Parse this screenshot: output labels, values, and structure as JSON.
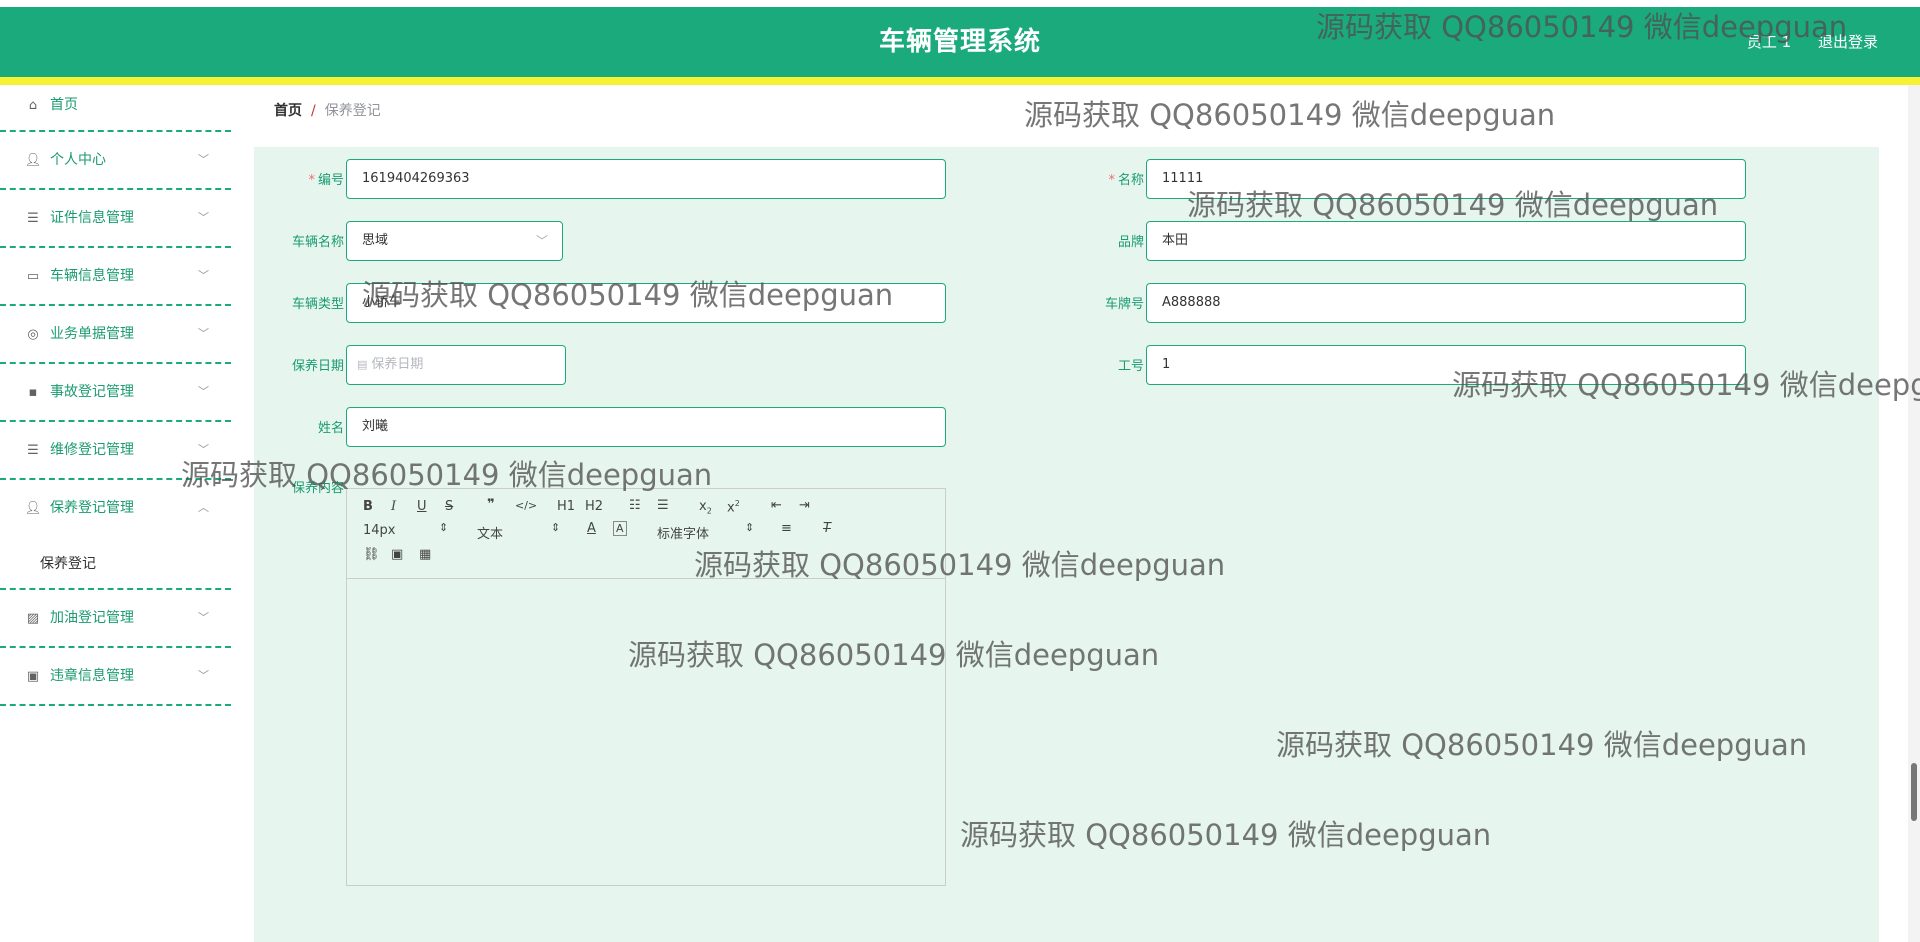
{
  "header": {
    "title": "车辆管理系统",
    "user": "员工 1",
    "logout": "退出登录"
  },
  "sidebar": {
    "items": [
      {
        "label": "首页",
        "icon": "home-icon"
      },
      {
        "label": "个人中心",
        "icon": "user-icon"
      },
      {
        "label": "证件信息管理",
        "icon": "list-icon"
      },
      {
        "label": "车辆信息管理",
        "icon": "chat-icon"
      },
      {
        "label": "业务单据管理",
        "icon": "compass-icon"
      },
      {
        "label": "事故登记管理",
        "icon": "message-icon"
      },
      {
        "label": "维修登记管理",
        "icon": "list-icon"
      },
      {
        "label": "保养登记管理",
        "icon": "user-icon"
      },
      {
        "label": "加油登记管理",
        "icon": "chart-icon"
      },
      {
        "label": "违章信息管理",
        "icon": "clipboard-icon"
      }
    ],
    "submenu": "保养登记"
  },
  "breadcrumb": {
    "home": "首页",
    "separator": "/",
    "current": "保养登记"
  },
  "form": {
    "bianhao": {
      "label": "编号",
      "value": "1619404269363"
    },
    "mingcheng": {
      "label": "名称",
      "value": "11111"
    },
    "cheliangmingcheng": {
      "label": "车辆名称",
      "value": "思域"
    },
    "pinpai": {
      "label": "品牌",
      "value": "本田"
    },
    "cheliangleixing": {
      "label": "车辆类型",
      "value": "小轿车"
    },
    "chepaihao": {
      "label": "车牌号",
      "value": "A888888"
    },
    "baoyangriqi": {
      "label": "保养日期",
      "placeholder": "保养日期"
    },
    "gonghao": {
      "label": "工号",
      "value": "1"
    },
    "xingming": {
      "label": "姓名",
      "value": "刘曦"
    },
    "baoyangneirong": {
      "label": "保养内容"
    }
  },
  "editor": {
    "font_size": "14px",
    "text_type": "文本",
    "font_family": "标准字体",
    "h1": "H1",
    "h2": "H2"
  },
  "watermark": "源码获取 QQ86050149 微信deepguan",
  "watermark_partial": "源码获取 QQ86050149 微信deepg",
  "colors": {
    "primary": "#1baa7c",
    "accent_bar": "#f6f231",
    "content_bg": "#e6f6ef"
  }
}
